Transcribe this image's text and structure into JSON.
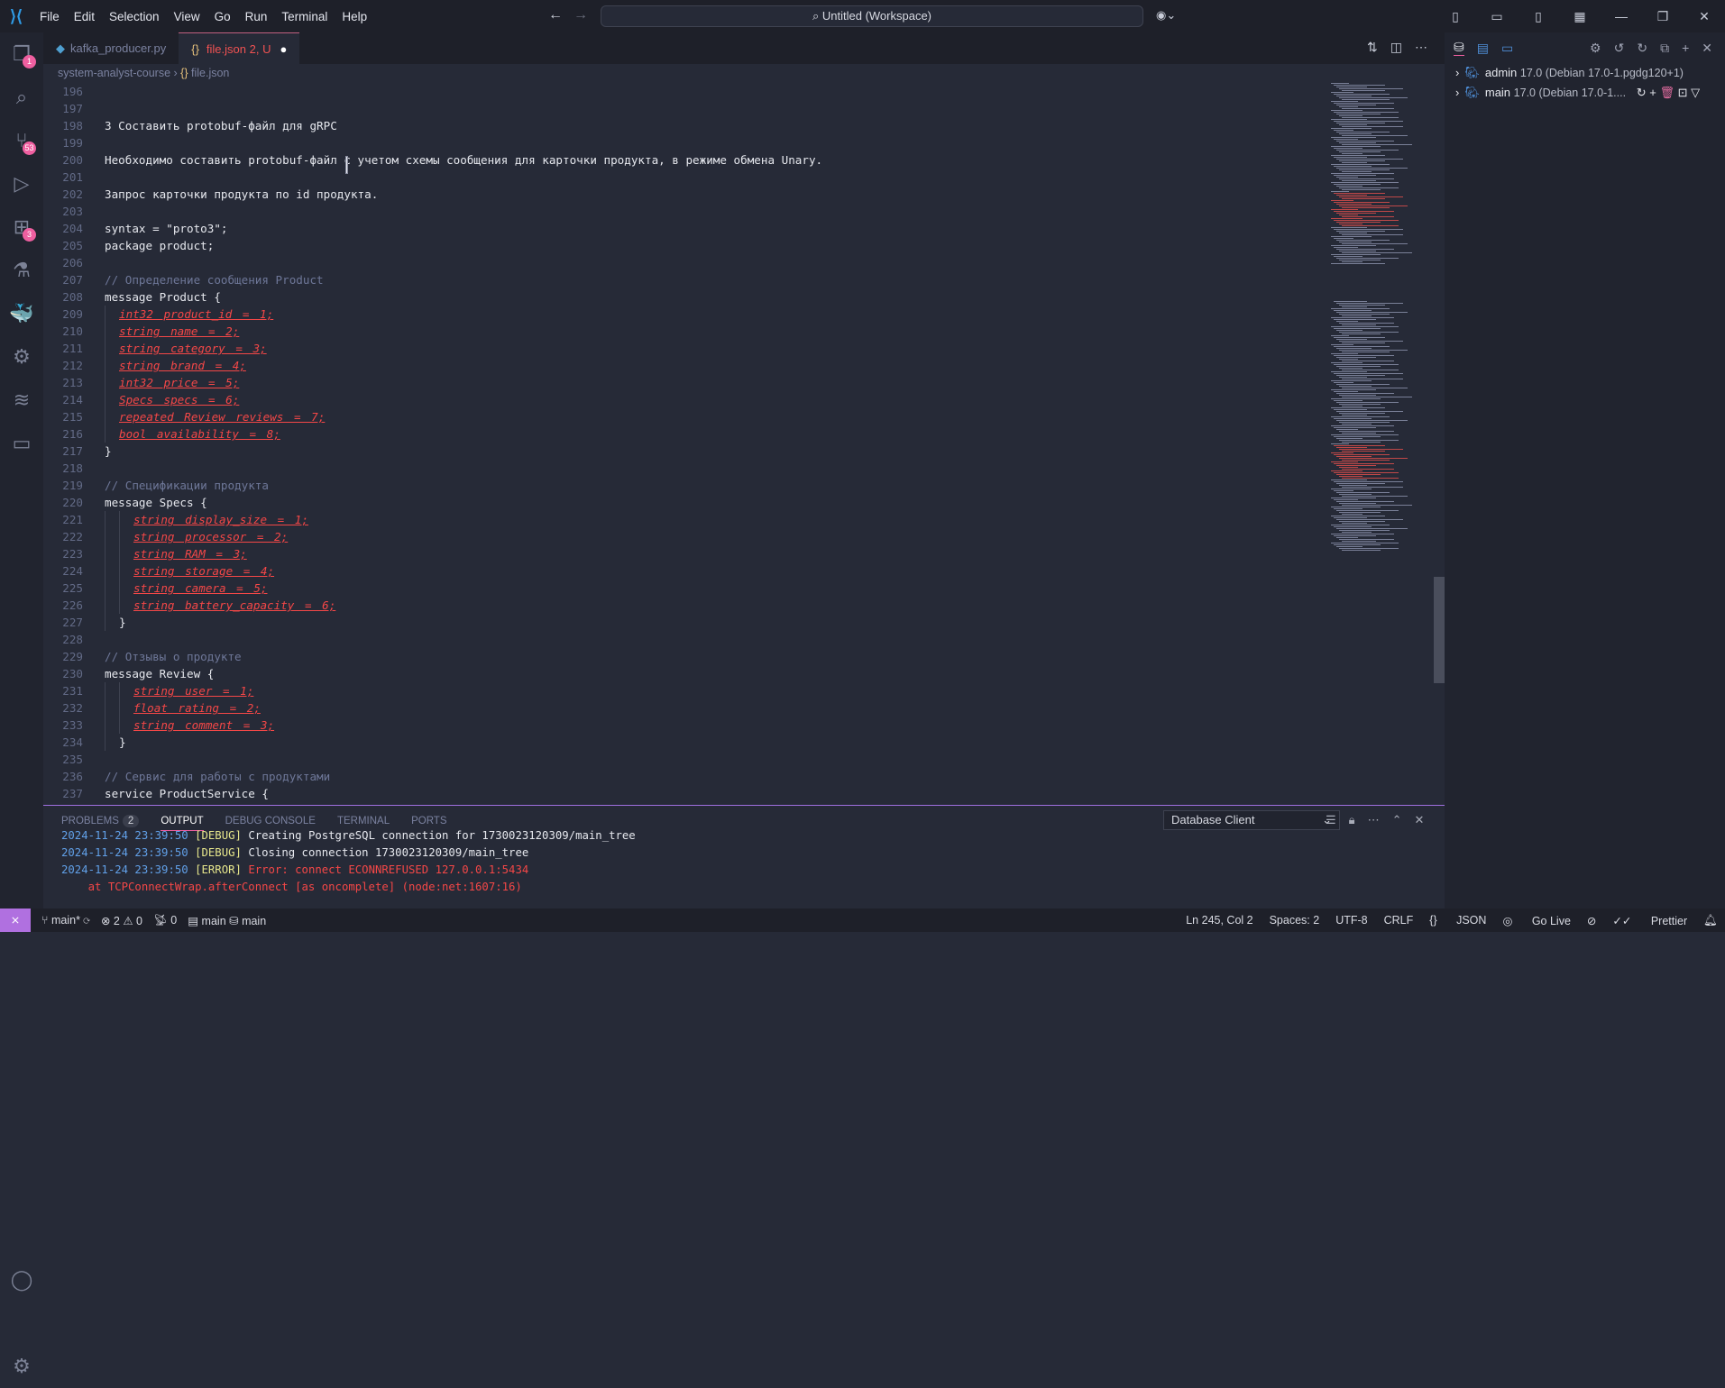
{
  "menu": [
    "File",
    "Edit",
    "Selection",
    "View",
    "Go",
    "Run",
    "Terminal",
    "Help"
  ],
  "command_center": "Untitled (Workspace)",
  "tabs": [
    {
      "label": "kafka_producer.py"
    },
    {
      "label": "file.json",
      "status": "2, U"
    }
  ],
  "breadcrumb": {
    "folder": "system-analyst-course",
    "file": "file.json"
  },
  "activity_badges": {
    "explorer": "1",
    "scm": "53",
    "extensions": "3"
  },
  "code_lines": [
    {
      "n": "196",
      "t": "plain",
      "text": ""
    },
    {
      "n": "197",
      "t": "plain",
      "text": ""
    },
    {
      "n": "198",
      "t": "plain",
      "text": "3 Составить protobuf-файл для gRPC"
    },
    {
      "n": "199",
      "t": "plain",
      "text": ""
    },
    {
      "n": "200",
      "t": "plain",
      "text": "Необходимо составить protobuf-файл с учетом схемы сообщения для карточки продукта, в режиме обмена Unary."
    },
    {
      "n": "201",
      "t": "plain",
      "text": ""
    },
    {
      "n": "202",
      "t": "plain",
      "text": "Запрос карточки продукта по id продукта."
    },
    {
      "n": "203",
      "t": "plain",
      "text": ""
    },
    {
      "n": "204",
      "t": "plain",
      "text": "syntax = \"proto3\";"
    },
    {
      "n": "205",
      "t": "plain",
      "text": "package product;"
    },
    {
      "n": "206",
      "t": "plain",
      "text": ""
    },
    {
      "n": "207",
      "t": "comment",
      "text": "// Определение сообщения Product"
    },
    {
      "n": "208",
      "t": "plain",
      "text": "message Product {"
    },
    {
      "n": "209",
      "t": "error",
      "i": 1,
      "text": "int32 product_id = 1;"
    },
    {
      "n": "210",
      "t": "error",
      "i": 1,
      "text": "string name = 2;"
    },
    {
      "n": "211",
      "t": "error",
      "i": 1,
      "text": "string category = 3;"
    },
    {
      "n": "212",
      "t": "error",
      "i": 1,
      "text": "string brand = 4;"
    },
    {
      "n": "213",
      "t": "error",
      "i": 1,
      "text": "int32 price = 5;"
    },
    {
      "n": "214",
      "t": "error",
      "i": 1,
      "text": "Specs specs = 6;"
    },
    {
      "n": "215",
      "t": "error",
      "i": 1,
      "text": "repeated Review reviews = 7;"
    },
    {
      "n": "216",
      "t": "error",
      "i": 1,
      "text": "bool availability = 8;"
    },
    {
      "n": "217",
      "t": "plain",
      "text": "}"
    },
    {
      "n": "218",
      "t": "plain",
      "text": ""
    },
    {
      "n": "219",
      "t": "comment",
      "text": "// Спецификации продукта"
    },
    {
      "n": "220",
      "t": "plain",
      "text": "message Specs {"
    },
    {
      "n": "221",
      "t": "error",
      "i": 2,
      "text": "string display_size = 1;"
    },
    {
      "n": "222",
      "t": "error",
      "i": 2,
      "text": "string processor = 2;"
    },
    {
      "n": "223",
      "t": "error",
      "i": 2,
      "text": "string RAM = 3;"
    },
    {
      "n": "224",
      "t": "error",
      "i": 2,
      "text": "string storage = 4;"
    },
    {
      "n": "225",
      "t": "error",
      "i": 2,
      "text": "string camera = 5;"
    },
    {
      "n": "226",
      "t": "error",
      "i": 2,
      "text": "string battery_capacity = 6;"
    },
    {
      "n": "227",
      "t": "plain",
      "i": 1,
      "text": "}"
    },
    {
      "n": "228",
      "t": "plain",
      "text": ""
    },
    {
      "n": "229",
      "t": "comment",
      "text": "// Отзывы о продукте"
    },
    {
      "n": "230",
      "t": "plain",
      "text": "message Review {"
    },
    {
      "n": "231",
      "t": "error",
      "i": 2,
      "text": "string user = 1;"
    },
    {
      "n": "232",
      "t": "error",
      "i": 2,
      "text": "float rating = 2;"
    },
    {
      "n": "233",
      "t": "error",
      "i": 2,
      "text": "string comment = 3;"
    },
    {
      "n": "234",
      "t": "plain",
      "i": 1,
      "text": "}"
    },
    {
      "n": "235",
      "t": "plain",
      "text": ""
    },
    {
      "n": "236",
      "t": "comment",
      "text": "// Сервис для работы с продуктами"
    },
    {
      "n": "237",
      "t": "plain",
      "text": "service ProductService {"
    }
  ],
  "panel": {
    "tabs": [
      "PROBLEMS",
      "OUTPUT",
      "DEBUG CONSOLE",
      "TERMINAL",
      "PORTS"
    ],
    "problems_count": "2",
    "output_channel": "Database Client",
    "log": [
      {
        "ts": "2024-11-24 23:39:50",
        "level": "[DEBUG]",
        "msg": "Creating PostgreSQL connection for 1730023120309/main_tree",
        "cls": "wt"
      },
      {
        "ts": "2024-11-24 23:39:50",
        "level": "[DEBUG]",
        "msg": "Closing connection 1730023120309/main_tree",
        "cls": "wt"
      },
      {
        "ts": "2024-11-24 23:39:50",
        "level": "[ERROR]",
        "msg": "Error: connect ECONNREFUSED 127.0.0.1:5434",
        "cls": "rd"
      }
    ],
    "stack": "    at TCPConnectWrap.afterConnect [as oncomplete] (node:net:1607:16)"
  },
  "sidebar": {
    "connections": [
      {
        "name": "admin",
        "version": "17.0 (Debian 17.0-1.pgdg120+1)"
      },
      {
        "name": "main",
        "version": "17.0 (Debian 17.0-1...."
      }
    ]
  },
  "status": {
    "branch": "main*",
    "errors": "2",
    "warnings": "0",
    "ports": "0",
    "db1": "main",
    "db2": "main",
    "position": "Ln 245, Col 2",
    "spaces": "Spaces: 2",
    "encoding": "UTF-8",
    "eol": "CRLF",
    "language": "JSON",
    "golive": "Go Live",
    "prettier": "Prettier"
  }
}
